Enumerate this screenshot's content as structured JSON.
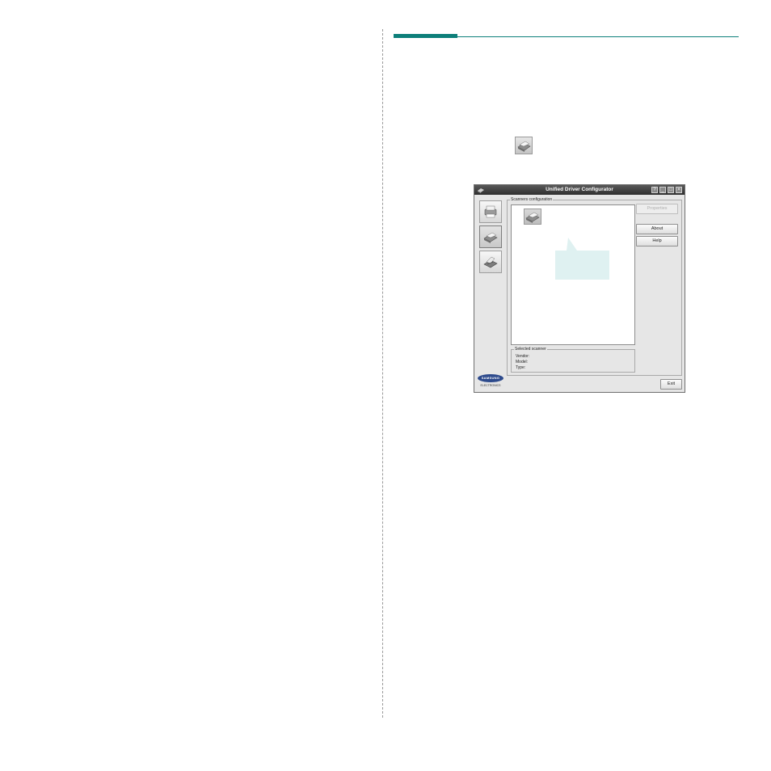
{
  "window": {
    "title": "Unified Driver Configurator",
    "controls": [
      "?",
      "_",
      "□",
      "×"
    ]
  },
  "sidebar": {
    "items": [
      {
        "name": "printers-configuration",
        "icon": "printer-icon",
        "active": false
      },
      {
        "name": "scanners-configuration",
        "icon": "scanner-icon",
        "active": true
      },
      {
        "name": "ports-configuration",
        "icon": "port-icon",
        "active": false
      }
    ]
  },
  "scanners": {
    "group_label": "Scanners configuration",
    "list_items": [
      {
        "icon": "scanner-icon"
      }
    ]
  },
  "selected": {
    "group_label": "Selected scanner",
    "vendor_label": "Vendor:",
    "model_label": "Model:",
    "type_label": "Type:"
  },
  "buttons": {
    "properties": "Properties",
    "about": "About",
    "help": "Help",
    "exit": "Exit"
  },
  "brand": {
    "logo": "SAMSUNG",
    "tagline": "ELECTRONICS"
  },
  "colors": {
    "accent": "#0d7f7a",
    "callout": "#dff1f1",
    "titlebar": "#3a3a3a"
  }
}
